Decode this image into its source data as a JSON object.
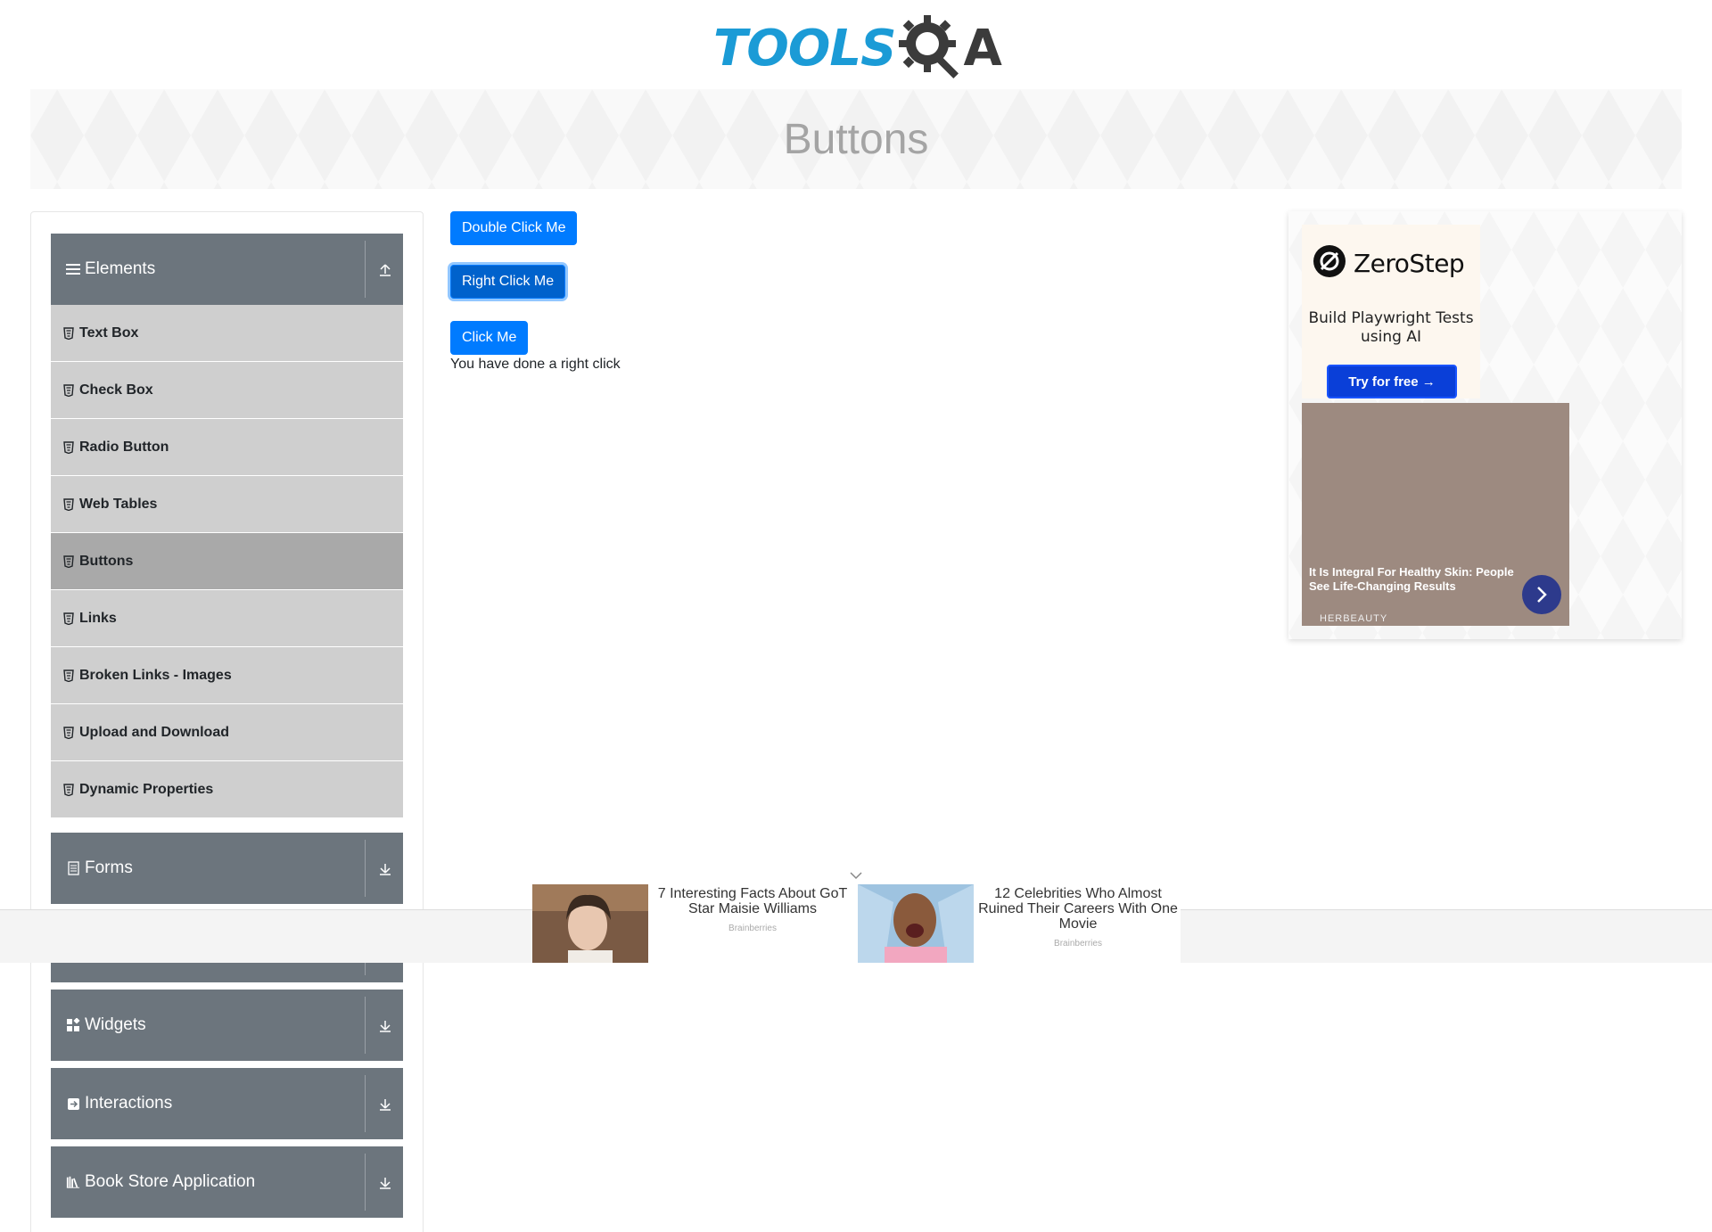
{
  "header": {
    "logo_tools": "TOOLS",
    "logo_a": "A",
    "brand_color": "#1b9bd6"
  },
  "banner": {
    "title": "Buttons"
  },
  "sidebar": {
    "groups": [
      {
        "label": "Elements",
        "icon": "hamburger-icon",
        "arrow": "collapse-arrow-icon"
      },
      {
        "label": "Forms",
        "icon": "document-icon",
        "arrow": "expand-arrow-icon"
      },
      {
        "label": "Widgets",
        "icon": "widgets-icon",
        "arrow": "expand-arrow-icon"
      },
      {
        "label": "Interactions",
        "icon": "interactions-icon",
        "arrow": "expand-arrow-icon"
      },
      {
        "label": "Book Store Application",
        "icon": "books-icon",
        "arrow": "expand-arrow-icon"
      }
    ],
    "elements_items": [
      {
        "label": "Text Box"
      },
      {
        "label": "Check Box"
      },
      {
        "label": "Radio Button"
      },
      {
        "label": "Web Tables"
      },
      {
        "label": "Buttons"
      },
      {
        "label": "Links"
      },
      {
        "label": "Broken Links - Images"
      },
      {
        "label": "Upload and Download"
      },
      {
        "label": "Dynamic Properties"
      }
    ],
    "active_item": "Buttons"
  },
  "main": {
    "double_click_label": "Double Click Me",
    "right_click_label": "Right Click Me",
    "click_label": "Click Me",
    "message": "You have done a right click",
    "button_color": "#007bff"
  },
  "ad_right": {
    "zerostep_name": "ZeroStep",
    "zerostep_tagline": "Build Playwright Tests using AI",
    "zerostep_cta": "Try for free →",
    "herbeauty_text": "It Is Integral For Healthy Skin: People See Life-Changing Results",
    "herbeauty_source": "HERBEAUTY"
  },
  "ad_bottom": {
    "items": [
      {
        "title": "7 Interesting Facts About GoT Star Maisie Williams",
        "source": "Brainberries"
      },
      {
        "title": "12 Celebrities Who Almost Ruined Their Careers With One Movie",
        "source": "Brainberries"
      }
    ]
  }
}
